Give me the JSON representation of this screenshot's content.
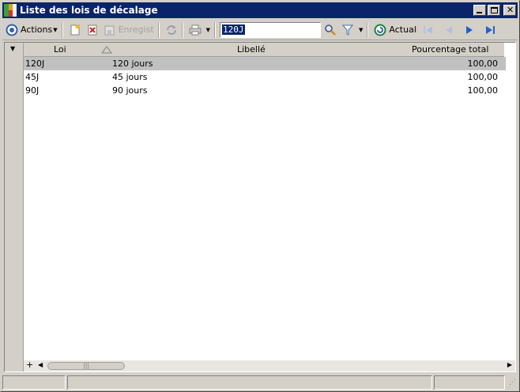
{
  "window": {
    "title": "Liste des lois de décalage"
  },
  "toolbar": {
    "actions_label": "Actions",
    "save_label": "Enregist",
    "refresh_label": "Actualis",
    "search_value": "120J"
  },
  "grid": {
    "columns": [
      "Loi",
      "Libellé",
      "Pourcentage total"
    ],
    "rows": [
      {
        "loi": "120J",
        "libelle": "120 jours",
        "pct": "100,00"
      },
      {
        "loi": "45J",
        "libelle": "45 jours",
        "pct": "100,00"
      },
      {
        "loi": "90J",
        "libelle": "90 jours",
        "pct": "100,00"
      }
    ]
  },
  "colors": {
    "titlebar": "#0a246a",
    "selected_row": "#c0c0c0",
    "nav_blue": "#2060d0"
  }
}
